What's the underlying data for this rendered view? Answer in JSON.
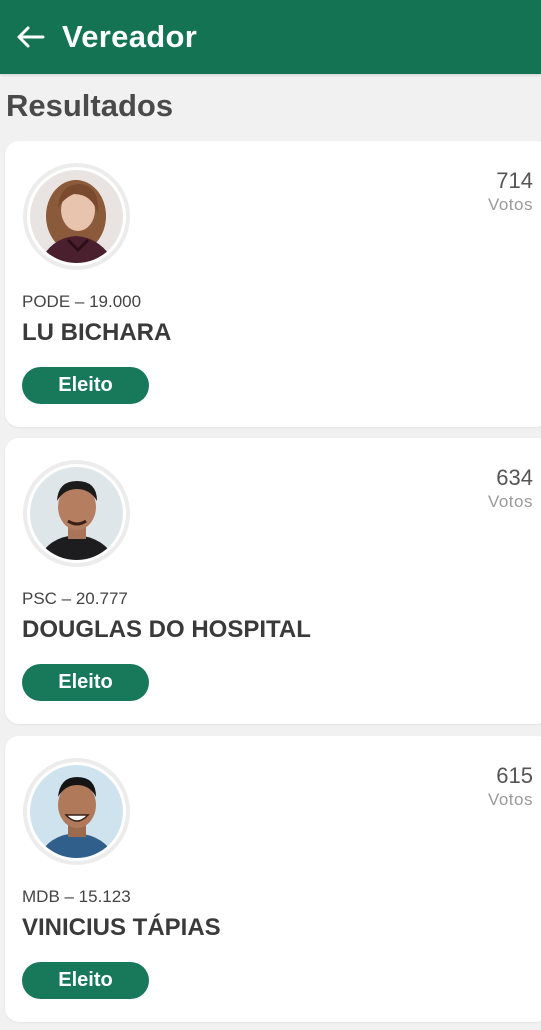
{
  "header": {
    "title": "Vereador",
    "back_icon": "arrow-left-icon",
    "color": "#137352"
  },
  "section": {
    "title": "Resultados"
  },
  "candidates": [
    {
      "votes": "714",
      "votes_label": "Votos",
      "party_number": "PODE – 19.000",
      "name": "LU BICHARA",
      "status": "Eleito",
      "photo": "candidate-photo-woman"
    },
    {
      "votes": "634",
      "votes_label": "Votos",
      "party_number": "PSC – 20.777",
      "name": "DOUGLAS DO HOSPITAL",
      "status": "Eleito",
      "photo": "candidate-photo-man"
    },
    {
      "votes": "615",
      "votes_label": "Votos",
      "party_number": "MDB – 15.123",
      "name": "VINICIUS TÁPIAS",
      "status": "Eleito",
      "photo": "candidate-photo-man"
    }
  ],
  "colors": {
    "accent": "#18795a",
    "background": "#f1f1f1"
  }
}
